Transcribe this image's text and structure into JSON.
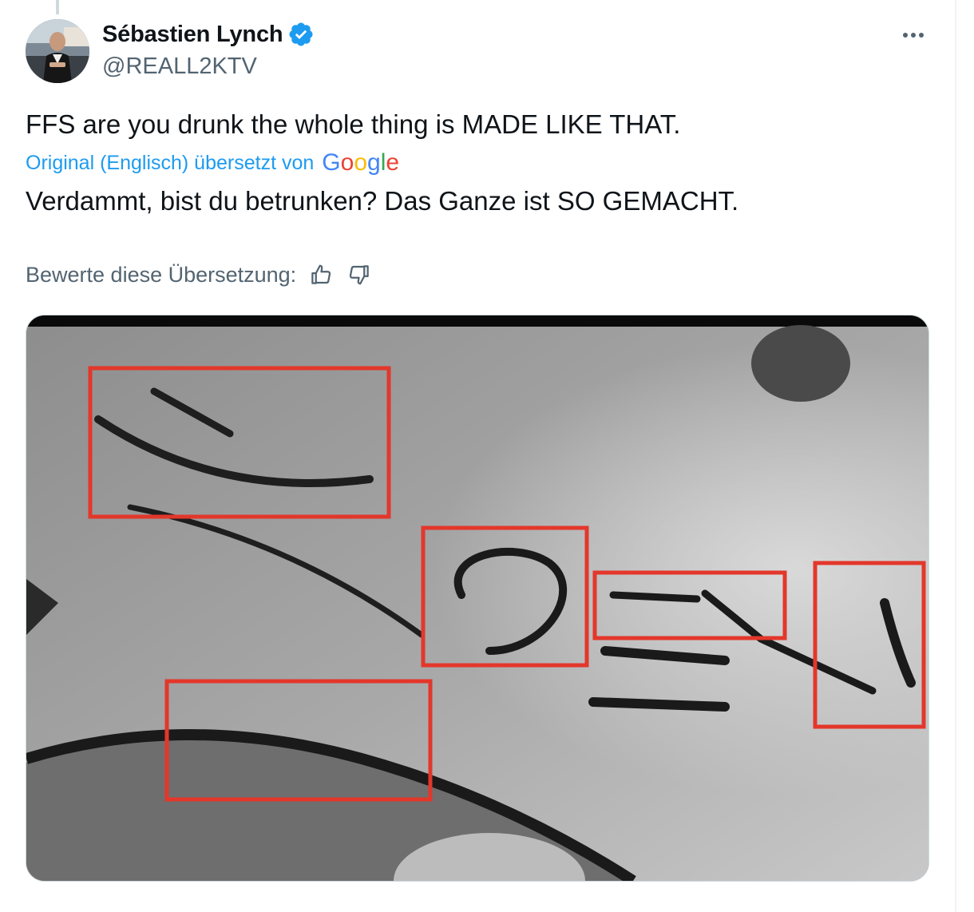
{
  "author": {
    "display_name": "Sébastien Lynch",
    "handle": "@REALL2KTV",
    "verified": true,
    "avatar_icon": "profile-photo"
  },
  "tweet": {
    "text": "FFS are you drunk the whole thing is MADE LIKE THAT.",
    "translated_label": "Original (Englisch) übersetzt von",
    "translator_brand": "Google",
    "translation": "Verdammt, bist du betrunken? Das Ganze ist SO GEMACHT."
  },
  "rating": {
    "label": "Bewerte diese Übersetzung:",
    "thumbs_up_icon": "thumbs-up-icon",
    "thumbs_down_icon": "thumbs-down-icon"
  },
  "colors": {
    "accent": "#1d9bf0",
    "secondary_text": "#536471",
    "verified_badge": "#1d9bf0",
    "highlight_box": "#e3372b"
  },
  "media": {
    "type": "photo",
    "highlight_box_count": 6
  }
}
